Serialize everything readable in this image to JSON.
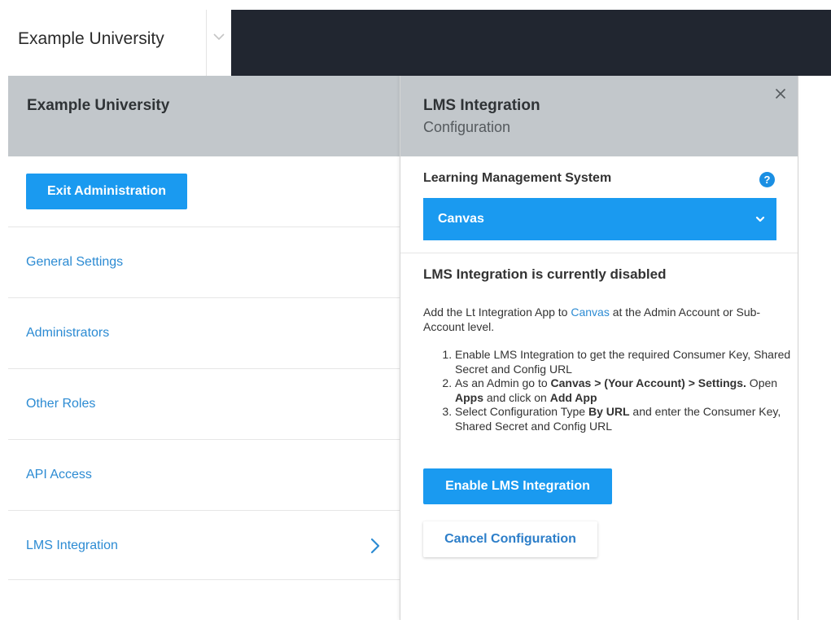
{
  "topbar": {
    "org_name": "Example University",
    "switch_icon": "chevron-down-icon",
    "band_color": "#212630"
  },
  "left_panel": {
    "title": "Example University",
    "exit_button": "Exit Administration",
    "nav": [
      {
        "label": "General Settings"
      },
      {
        "label": "Administrators"
      },
      {
        "label": "Other Roles"
      },
      {
        "label": "API Access"
      },
      {
        "label": "LMS Integration",
        "active": true,
        "icon": "chevron-right-icon"
      }
    ]
  },
  "right_panel": {
    "title": "LMS Integration",
    "subtitle": "Configuration",
    "close_icon": "close-icon",
    "lms_label": "Learning Management System",
    "help_icon": "question-circle-icon",
    "help_glyph": "?",
    "lms_select": {
      "value": "Canvas",
      "icon": "chevron-down-icon"
    },
    "status_title": "LMS Integration is currently disabled",
    "intro": {
      "prefix": "Add the Lt Integration App to ",
      "link": "Canvas",
      "suffix": " at the Admin Account or Sub-Account level."
    },
    "steps": {
      "s1": "Enable LMS Integration to get the required Consumer Key, Shared Secret and Config URL",
      "s2": {
        "p1": "As an Admin go to ",
        "b1": "Canvas > (Your Account) > Settings.",
        "p2": " Open ",
        "b2": "Apps",
        "p3": " and click on ",
        "b3": "Add App"
      },
      "s3": {
        "p1": "Select Configuration Type ",
        "b1": "By URL",
        "p2": " and enter the Consumer Key, Shared Secret and Config URL"
      }
    },
    "enable_button": "Enable LMS Integration",
    "cancel_button": "Cancel Configuration"
  },
  "colors": {
    "accent": "#1a9af0",
    "link": "#2c8bd3",
    "header_bg": "#c2c7cb"
  }
}
